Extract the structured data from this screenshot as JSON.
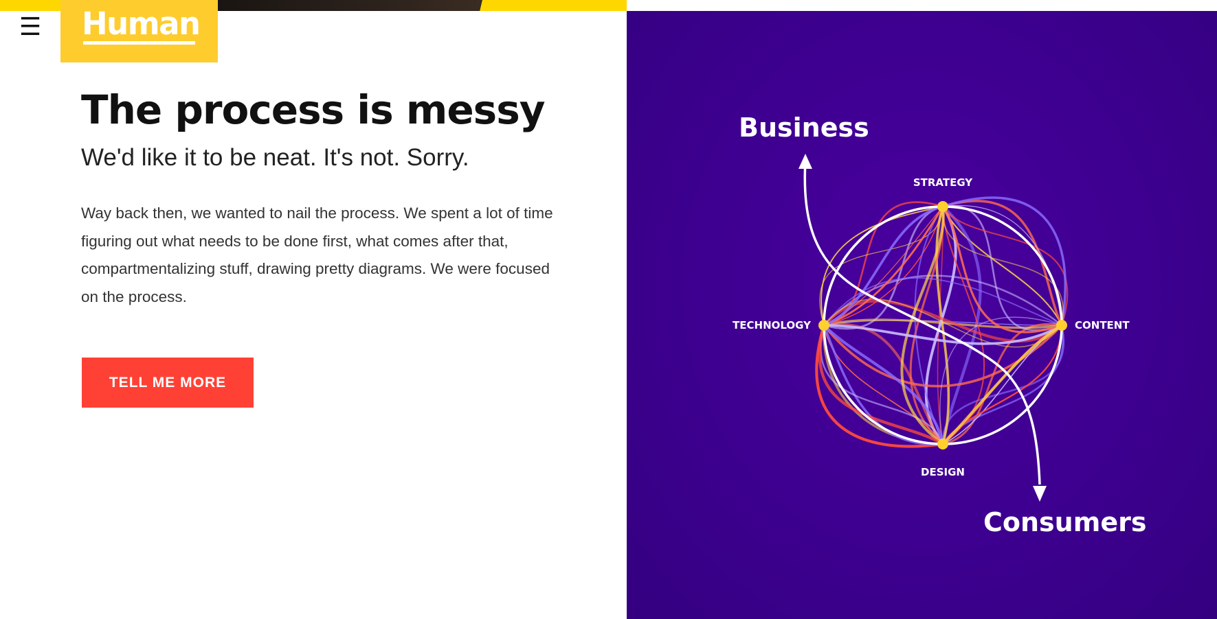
{
  "nav": {
    "menu_glyph": "☰",
    "menu_icon": "hamburger-menu-icon",
    "logo_text": "Human"
  },
  "hero": {
    "headline": "The process is messy",
    "subheadline": "We'd like it to be neat. It's not. Sorry.",
    "body": "Way back then, we wanted to nail the process. We spent a lot of time figuring out what needs to be done first, what comes after that, compartmentalizing stuff, drawing pretty diagrams. We were focused on the process.",
    "cta_label": "TELL ME MORE"
  },
  "diagram": {
    "top_label": "Business",
    "bottom_label": "Consumers",
    "nodes": {
      "top": "STRATEGY",
      "left": "TECHNOLOGY",
      "right": "CONTENT",
      "bottom": "DESIGN"
    }
  },
  "colors": {
    "brand_yellow": "#ffcc2e",
    "top_strip_yellow": "#ffd700",
    "cta_red": "#ff4135",
    "panel_purple": "#3c008e",
    "node_yellow": "#ffd02e",
    "thread_red": "#ff4a3d",
    "thread_violet": "#8a6cff",
    "thread_yellow": "#ffd24a"
  }
}
